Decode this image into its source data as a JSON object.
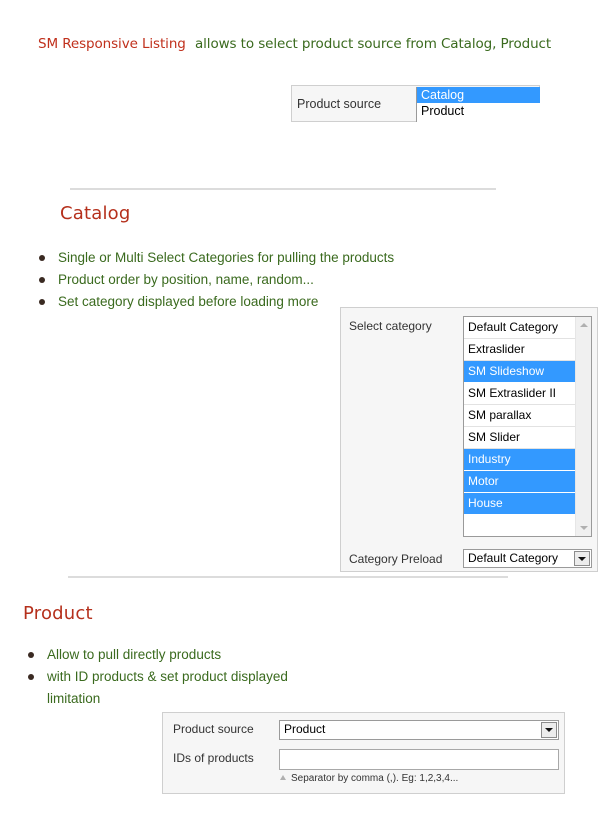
{
  "intro": {
    "brand": "SM Responsive Listing",
    "text": "allows to select product source from Catalog, Product"
  },
  "source_selector": {
    "label": "Product source",
    "options": [
      {
        "label": "Catalog",
        "selected": true
      },
      {
        "label": "Product",
        "selected": false
      }
    ]
  },
  "catalog": {
    "title": "Catalog",
    "bullets": [
      "Single or Multi Select Categories for pulling the products",
      "Product order by position, name, random...",
      "Set category displayed before loading more"
    ],
    "panel": {
      "select_label": "Select category",
      "categories": [
        {
          "label": "Default Category",
          "selected": false
        },
        {
          "label": "Extraslider",
          "selected": false
        },
        {
          "label": "SM Slideshow",
          "selected": true
        },
        {
          "label": "SM Extraslider II",
          "selected": false
        },
        {
          "label": "SM parallax",
          "selected": false
        },
        {
          "label": "SM Slider",
          "selected": false
        },
        {
          "label": "Industry",
          "selected": true
        },
        {
          "label": "Motor",
          "selected": true
        },
        {
          "label": "House",
          "selected": true
        }
      ],
      "preload_label": "Category Preload",
      "preload_value": "Default Category"
    }
  },
  "product": {
    "title": "Product",
    "bullets": [
      "Allow to pull directly products",
      "with ID products & set product displayed limitation"
    ],
    "panel": {
      "source_label": "Product source",
      "source_value": "Product",
      "ids_label": "IDs of products",
      "ids_value": "",
      "hint": "Separator by comma (,). Eg: 1,2,3,4..."
    }
  },
  "colors": {
    "brand_red": "#c0301c",
    "text_green": "#3a6a1e",
    "selection_blue": "#3399ff"
  }
}
